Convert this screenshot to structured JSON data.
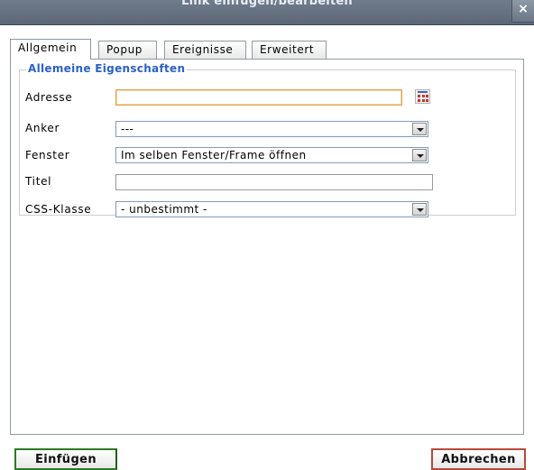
{
  "window": {
    "title": "Link einfügen/bearbeiten",
    "close_label": "×"
  },
  "tabs": [
    {
      "label": "Allgemein",
      "active": true
    },
    {
      "label": "Popup",
      "active": false
    },
    {
      "label": "Ereignisse",
      "active": false
    },
    {
      "label": "Erweitert",
      "active": false
    }
  ],
  "general": {
    "legend": "Allemeine Eigenschaften",
    "address": {
      "label": "Adresse",
      "value": ""
    },
    "anchor": {
      "label": "Anker",
      "value": "---"
    },
    "window_target": {
      "label": "Fenster",
      "value": "Im selben Fenster/Frame öffnen"
    },
    "title": {
      "label": "Titel",
      "value": ""
    },
    "css_class": {
      "label": "CSS-Klasse",
      "value": "- unbestimmt -"
    }
  },
  "buttons": {
    "insert": "Einfügen",
    "cancel": "Abbrechen"
  },
  "colors": {
    "legend": "#2b61c5",
    "insert_border": "#2c7a25",
    "cancel_border": "#b54a3b",
    "focus_border": "#e0a04a"
  },
  "icons": {
    "browse": "file-browser-icon",
    "dropdown": "chevron-down-icon"
  }
}
